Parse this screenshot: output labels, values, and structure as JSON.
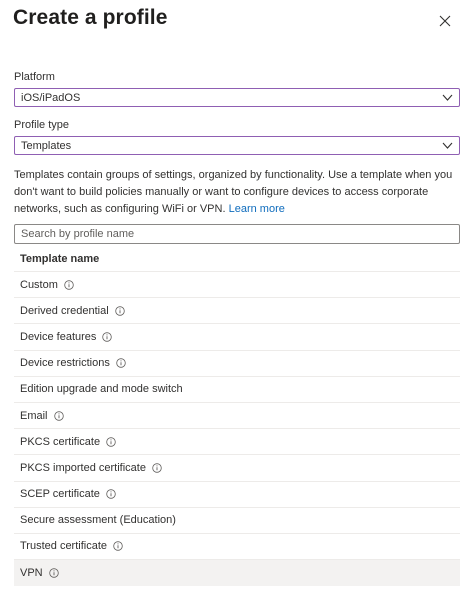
{
  "dialog": {
    "title": "Create a profile"
  },
  "platform": {
    "label": "Platform",
    "value": "iOS/iPadOS"
  },
  "profile_type": {
    "label": "Profile type",
    "value": "Templates"
  },
  "description": {
    "text": "Templates contain groups of settings, organized by functionality. Use a template when you don't want to build policies manually or want to configure devices to access corporate networks, such as configuring WiFi or VPN.",
    "link": "Learn more"
  },
  "search": {
    "placeholder": "Search by profile name"
  },
  "table": {
    "header": "Template name",
    "rows": [
      {
        "name": "Custom",
        "info": true
      },
      {
        "name": "Derived credential",
        "info": true
      },
      {
        "name": "Device features",
        "info": true
      },
      {
        "name": "Device restrictions",
        "info": true
      },
      {
        "name": "Edition upgrade and mode switch",
        "info": false
      },
      {
        "name": "Email",
        "info": true
      },
      {
        "name": "PKCS certificate",
        "info": true
      },
      {
        "name": "PKCS imported certificate",
        "info": true
      },
      {
        "name": "SCEP certificate",
        "info": true
      },
      {
        "name": "Secure assessment (Education)",
        "info": false
      },
      {
        "name": "Trusted certificate",
        "info": true
      },
      {
        "name": "VPN",
        "info": true
      }
    ],
    "selected_row": "VPN"
  },
  "colors": {
    "dropdown_border": "#8f5fb3",
    "link": "#0f6cbd",
    "selected_row": "#f3f2f1"
  }
}
